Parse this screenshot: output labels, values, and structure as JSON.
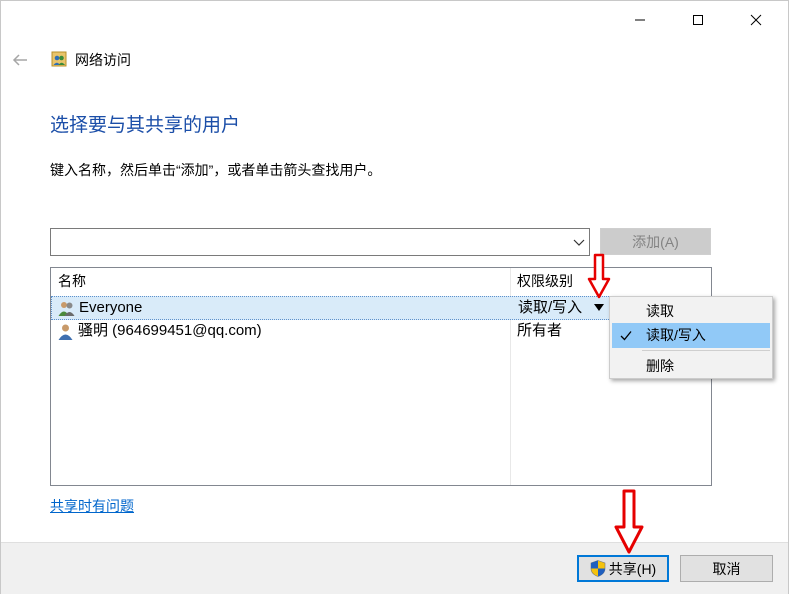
{
  "window": {
    "nav_title": "网络访问",
    "heading": "选择要与其共享的用户",
    "instructions": "键入名称，然后单击“添加”，或者单击箭头查找用户。"
  },
  "combo": {
    "value": ""
  },
  "add_button": {
    "label": "添加(A)"
  },
  "list": {
    "columns": [
      "名称",
      "权限级别"
    ],
    "rows": [
      {
        "name": "Everyone",
        "permission": "读取/写入",
        "icon": "group-user-icon",
        "selected": true
      },
      {
        "name": "骚明 (964699451@qq.com)",
        "permission": "所有者",
        "icon": "user-icon",
        "selected": false
      }
    ]
  },
  "permission_menu": {
    "items": [
      {
        "label": "读取",
        "checked": false
      },
      {
        "label": "读取/写入",
        "checked": true
      },
      {
        "label": "删除",
        "checked": false
      }
    ]
  },
  "problem_link": "共享时有问题",
  "buttons": {
    "share": "共享(H)",
    "cancel": "取消"
  },
  "colors": {
    "accent": "#0078d7",
    "heading": "#1b4ea8",
    "menu_highlight": "#91c9f7",
    "annotation": "#e60000"
  }
}
